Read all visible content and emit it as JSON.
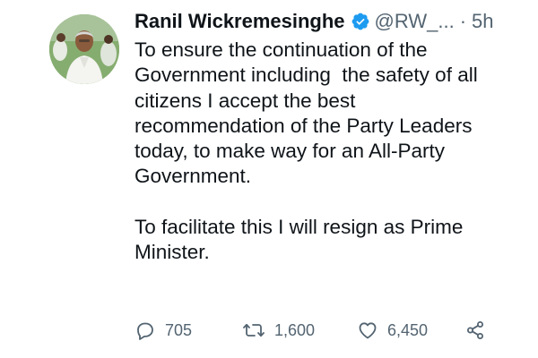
{
  "tweet": {
    "author": {
      "display_name": "Ranil Wickremesinghe",
      "handle": "@RW_...",
      "verified_icon": "verified-badge-icon",
      "avatar_icon": "profile-photo"
    },
    "separator": "·",
    "timestamp": "5h",
    "text": "To ensure the continuation of the\nGovernment including  the safety of all\ncitizens I accept the best\nrecommendation of the Party Leaders\ntoday, to make way for an All-Party\nGovernment.\n\nTo facilitate this I will resign as Prime\nMinister.",
    "actions": {
      "replies": "705",
      "retweets": "1,600",
      "likes": "6,450",
      "reply_icon": "reply-icon",
      "retweet_icon": "retweet-icon",
      "like_icon": "heart-icon",
      "share_icon": "share-icon"
    }
  },
  "colors": {
    "text": "#0f1419",
    "secondary": "#536471",
    "verified": "#1d9bf0",
    "background": "#ffffff"
  }
}
